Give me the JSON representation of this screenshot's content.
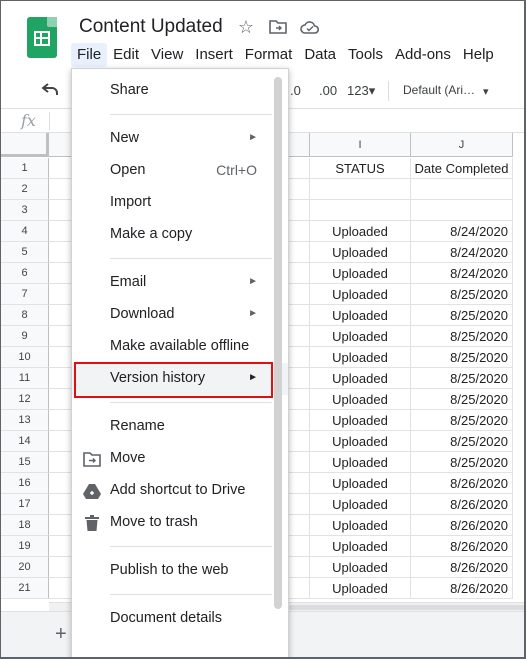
{
  "app": {
    "doc_title": "Content Updated",
    "menubar": [
      "File",
      "Edit",
      "View",
      "Insert",
      "Format",
      "Data",
      "Tools",
      "Add-ons",
      "Help"
    ],
    "toolbar": {
      "dec_decrease": ".0",
      "dec_increase": ".00",
      "format_more": "123▾",
      "font": "Default (Ari…",
      "font_caret": "▾"
    },
    "formula_icon": "fx"
  },
  "columns": [
    {
      "letter": "I",
      "header": "STATUS"
    },
    {
      "letter": "J",
      "header": "Date Completed"
    }
  ],
  "rows": [
    {
      "n": "1",
      "status": "STATUS",
      "date": "Date Completed"
    },
    {
      "n": "2",
      "status": "",
      "date": ""
    },
    {
      "n": "3",
      "status": "",
      "date": ""
    },
    {
      "n": "4",
      "status": "Uploaded",
      "date": "8/24/2020"
    },
    {
      "n": "5",
      "status": "Uploaded",
      "date": "8/24/2020"
    },
    {
      "n": "6",
      "status": "Uploaded",
      "date": "8/24/2020"
    },
    {
      "n": "7",
      "status": "Uploaded",
      "date": "8/25/2020"
    },
    {
      "n": "8",
      "status": "Uploaded",
      "date": "8/25/2020"
    },
    {
      "n": "9",
      "status": "Uploaded",
      "date": "8/25/2020"
    },
    {
      "n": "10",
      "status": "Uploaded",
      "date": "8/25/2020"
    },
    {
      "n": "11",
      "status": "Uploaded",
      "date": "8/25/2020"
    },
    {
      "n": "12",
      "status": "Uploaded",
      "date": "8/25/2020"
    },
    {
      "n": "13",
      "status": "Uploaded",
      "date": "8/25/2020"
    },
    {
      "n": "14",
      "status": "Uploaded",
      "date": "8/25/2020"
    },
    {
      "n": "15",
      "status": "Uploaded",
      "date": "8/25/2020"
    },
    {
      "n": "16",
      "status": "Uploaded",
      "date": "8/26/2020"
    },
    {
      "n": "17",
      "status": "Uploaded",
      "date": "8/26/2020"
    },
    {
      "n": "18",
      "status": "Uploaded",
      "date": "8/26/2020"
    },
    {
      "n": "19",
      "status": "Uploaded",
      "date": "8/26/2020"
    },
    {
      "n": "20",
      "status": "Uploaded",
      "date": "8/26/2020"
    },
    {
      "n": "21",
      "status": "Uploaded",
      "date": "8/26/2020"
    }
  ],
  "add_sheet": "+",
  "file_menu": {
    "share": "Share",
    "new": "New",
    "open": "Open",
    "open_shortcut": "Ctrl+O",
    "import": "Import",
    "make_copy": "Make a copy",
    "email": "Email",
    "download": "Download",
    "offline": "Make available offline",
    "version_history": "Version history",
    "rename": "Rename",
    "move": "Move",
    "add_shortcut": "Add shortcut to Drive",
    "trash": "Move to trash",
    "publish": "Publish to the web",
    "details": "Document details",
    "submenu_arrow": "►"
  },
  "colors": {
    "highlight_border": "#e01010",
    "menu_active": "#e8f0fe",
    "logo": "#1fa463"
  },
  "icons": [
    "sheets-logo-icon",
    "star-icon",
    "move-folder-icon",
    "cloud-saved-icon",
    "undo-icon",
    "move-icon",
    "add-shortcut-icon",
    "trash-icon"
  ]
}
